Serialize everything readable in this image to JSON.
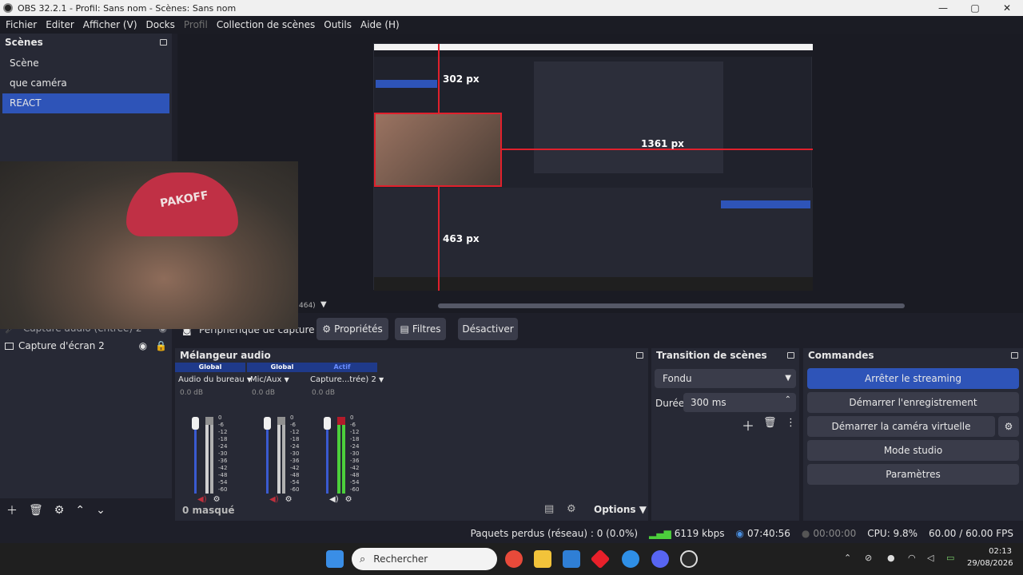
{
  "window": {
    "title": "OBS 32.2.1 - Profil: Sans nom - Scènes: Sans nom",
    "minimize": "—",
    "maximize": "▢",
    "close": "✕"
  },
  "menu": [
    "Fichier",
    "Editer",
    "Afficher (V)",
    "Docks",
    "Profil",
    "Collection de scènes",
    "Outils",
    "Aide (H)"
  ],
  "scenes": {
    "title": "Scènes",
    "items": [
      "Scène",
      "que caméra",
      "REACT"
    ],
    "selected": "REACT"
  },
  "preview": {
    "measure_top": "302 px",
    "measure_right": "1361 px",
    "measure_left": "463 px",
    "cropped_label": "464)"
  },
  "sources": {
    "items": [
      {
        "name": "Capture audio (entrée) 2"
      },
      {
        "name": "Capture d'écran 2"
      }
    ]
  },
  "source_toolbar": {
    "selected": "Périphérique de capture vi",
    "properties": "Propriétés",
    "filters": "Filtres",
    "deactivate": "Désactiver"
  },
  "mixer": {
    "title": "Mélangeur audio",
    "channels": [
      {
        "tag": "Global",
        "name": "Audio du bureau",
        "db": "0.0 dB"
      },
      {
        "tag": "Global",
        "name": "Mic/Aux",
        "db": "0.0 dB"
      },
      {
        "tag": "Actif",
        "name": "Capture...trée) 2",
        "db": "0.0 dB"
      }
    ],
    "scale": [
      "0",
      "-6",
      "-12",
      "-18",
      "-24",
      "-30",
      "-36",
      "-42",
      "-48",
      "-54",
      "-60"
    ],
    "hidden": "0 masqué",
    "options": "Options"
  },
  "transitions": {
    "title": "Transition de scènes",
    "type": "Fondu",
    "duration_label": "Durée",
    "duration": "300 ms"
  },
  "commands": {
    "title": "Commandes",
    "stop_stream": "Arrêter le streaming",
    "start_record": "Démarrer l'enregistrement",
    "virtual_cam": "Démarrer la caméra virtuelle",
    "studio": "Mode studio",
    "settings": "Paramètres"
  },
  "status": {
    "dropped": "Paquets perdus (réseau) : 0 (0.0%)",
    "bitrate": "6119 kbps",
    "stream_time": "07:40:56",
    "rec_time": "00:00:00",
    "cpu": "CPU: 9.8%",
    "fps": "60.00 / 60.00 FPS"
  },
  "taskbar": {
    "search": "Rechercher",
    "time": "02:13",
    "date": "29/08/2026"
  },
  "colors": {
    "accent": "#2e54b8",
    "panel": "#272935",
    "bg": "#1e1f29",
    "red": "#e0202c",
    "meter_green": "#4ccf3c"
  }
}
